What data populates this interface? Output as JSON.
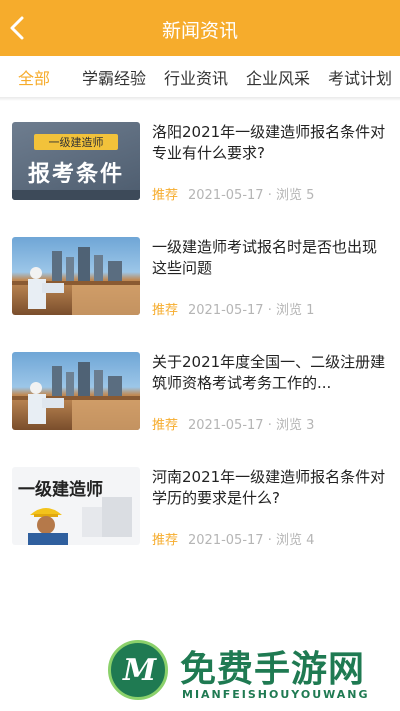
{
  "header": {
    "title": "新闻资讯"
  },
  "tabs": [
    {
      "label": "全部"
    },
    {
      "label": "学霸经验"
    },
    {
      "label": "行业资讯"
    },
    {
      "label": "企业风采"
    },
    {
      "label": "考试计划"
    }
  ],
  "articles": [
    {
      "title": "洛阳2021年一级建造师报名条件对专业有什么要求?",
      "tag": "推荐",
      "date": "2021-05-17",
      "views_label": "浏览 5",
      "thumb_badge": "一级建造师",
      "thumb_headline": "报考条件"
    },
    {
      "title": "一级建造师考试报名时是否也出现这些问题",
      "tag": "推荐",
      "date": "2021-05-17",
      "views_label": "浏览 1"
    },
    {
      "title": "关于2021年度全国一、二级注册建筑师资格考试考务工作的...",
      "tag": "推荐",
      "date": "2021-05-17",
      "views_label": "浏览 3"
    },
    {
      "title": "河南2021年一级建造师报名条件对学历的要求是什么?",
      "tag": "推荐",
      "date": "2021-05-17",
      "views_label": "浏览 4",
      "thumb_headline": "一级建造师"
    }
  ],
  "watermark": {
    "logo_letter": "M",
    "title": "免费手游网",
    "subtitle": "MIANFEISHOUYOUWANG"
  },
  "colors": {
    "accent": "#f6ac2c",
    "meta": "#b5b5b5",
    "watermark": "#1f7a52"
  }
}
